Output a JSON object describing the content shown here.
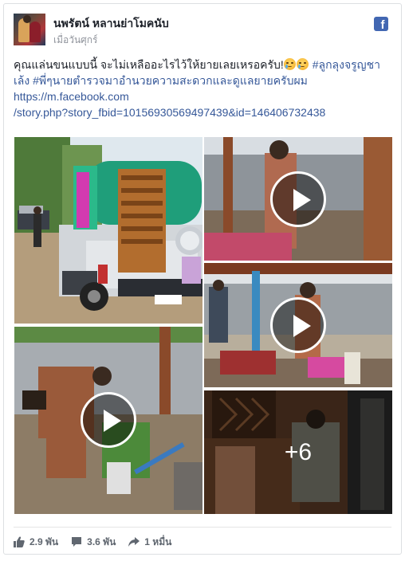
{
  "post": {
    "page_name": "นพรัตน์ หลานย่าโมคนับ",
    "time": "เมื่อวันศุกร์",
    "text_main": "คุณแล่นขนแบบนี้ จะไม่เหลืออะไรไว้ให้ยายเลยเหรอครับ!",
    "hashtag1": "#ลูกลุงจรูญชาเล้ง",
    "hashtag2": "#พี่ๆนายตำรวจมาอำนวยความสะดวกและดูแลยายครับผม",
    "link_line1": "https://m.facebook.com",
    "link_line2": "/story.php?story_fbid=10156930569497439&id=146406732438",
    "more_photos": "+6"
  },
  "stats": {
    "likes": "2.9 พัน",
    "comments": "3.6 พัน",
    "shares": "1 หมื่น"
  },
  "icons": {
    "brand": "facebook-logo-icon",
    "like": "thumbs-up-icon",
    "comment": "comment-bubble-icon",
    "share": "share-arrow-icon",
    "play": "play-icon"
  },
  "colors": {
    "link": "#365899",
    "brand": "#4267b2",
    "meta": "#90949c"
  }
}
